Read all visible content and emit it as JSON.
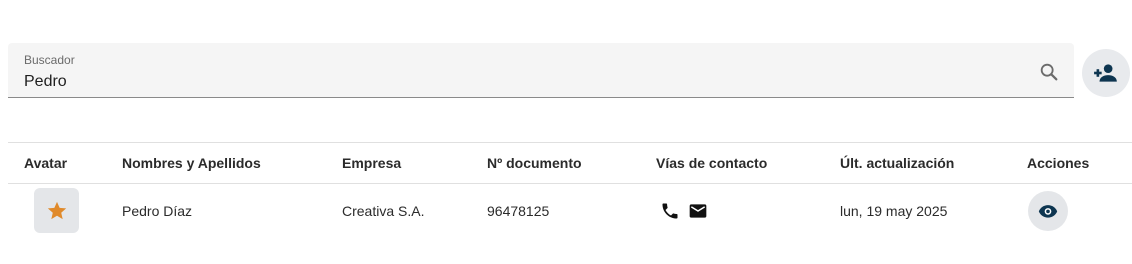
{
  "search": {
    "label": "Buscador",
    "value": "Pedro",
    "icon": "search-icon"
  },
  "add_user_button": {
    "icon": "person-add-icon"
  },
  "table": {
    "columns": [
      "Avatar",
      "Nombres y Apellidos",
      "Empresa",
      "Nº documento",
      "Vías de contacto",
      "Últ. actualización",
      "Acciones"
    ],
    "rows": [
      {
        "avatar_icon": "star-icon",
        "avatar_color": "#e08a2b",
        "name": "Pedro Díaz",
        "company": "Creativa S.A.",
        "document": "96478125",
        "contact_icons": [
          "phone-icon",
          "email-icon"
        ],
        "updated": "lun, 19 may 2025",
        "action_icon": "eye-icon"
      }
    ]
  },
  "colors": {
    "accent_dark": "#0d3550",
    "avatar_bg": "#e4e6e9"
  }
}
